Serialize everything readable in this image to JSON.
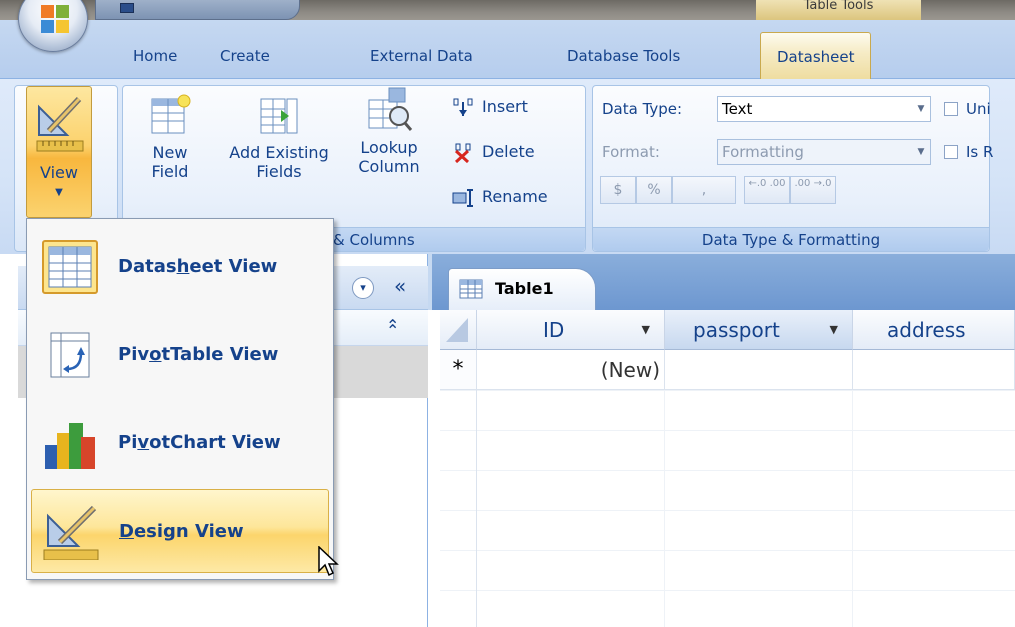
{
  "window": {
    "context_tab_header": "Table Tools"
  },
  "tabs": [
    {
      "label": "Home"
    },
    {
      "label": "Create"
    },
    {
      "label": "External Data"
    },
    {
      "label": "Database Tools"
    },
    {
      "label": "Datasheet"
    }
  ],
  "ribbon": {
    "view_button": {
      "label": "View"
    },
    "fields_group": {
      "new_field": [
        "New",
        "Field"
      ],
      "add_existing": [
        "Add Existing",
        "Fields"
      ],
      "lookup_column": [
        "Lookup",
        "Column"
      ],
      "insert": "Insert",
      "delete": "Delete",
      "rename": "Rename",
      "label": "& Columns"
    },
    "data_type_group": {
      "data_type_label": "Data Type:",
      "data_type_value": "Text",
      "format_label": "Format:",
      "format_value": "Formatting",
      "unique_label": "Uni",
      "required_label": "Is R",
      "currency": "$",
      "percent": "%",
      "comma": ",",
      "increase_decimals": "←.0 .00",
      "decrease_decimals": ".00 →.0",
      "label": "Data Type & Formatting"
    }
  },
  "view_menu": {
    "items": [
      {
        "pre": "Datas",
        "ul": "h",
        "post": "eet View"
      },
      {
        "pre": "Piv",
        "ul": "o",
        "post": "tTable View"
      },
      {
        "pre": "Pi",
        "ul": "v",
        "post": "otChart View"
      },
      {
        "pre": "",
        "ul": "D",
        "post": "esign View"
      }
    ]
  },
  "nav_pane": {
    "dropdown_glyph": "▾",
    "collapse_glyph": "«",
    "section_collapse_glyph": "⌃"
  },
  "document": {
    "tab_label": "Table1",
    "columns": [
      {
        "label": "ID"
      },
      {
        "label": "passport"
      },
      {
        "label": "address"
      }
    ],
    "new_row_marker": "*",
    "new_row_id": "(New)"
  },
  "colors": {
    "accent_text": "#15428b",
    "ribbon_bg": "#d4e3f7",
    "hover_gold": "#fcd56c"
  }
}
